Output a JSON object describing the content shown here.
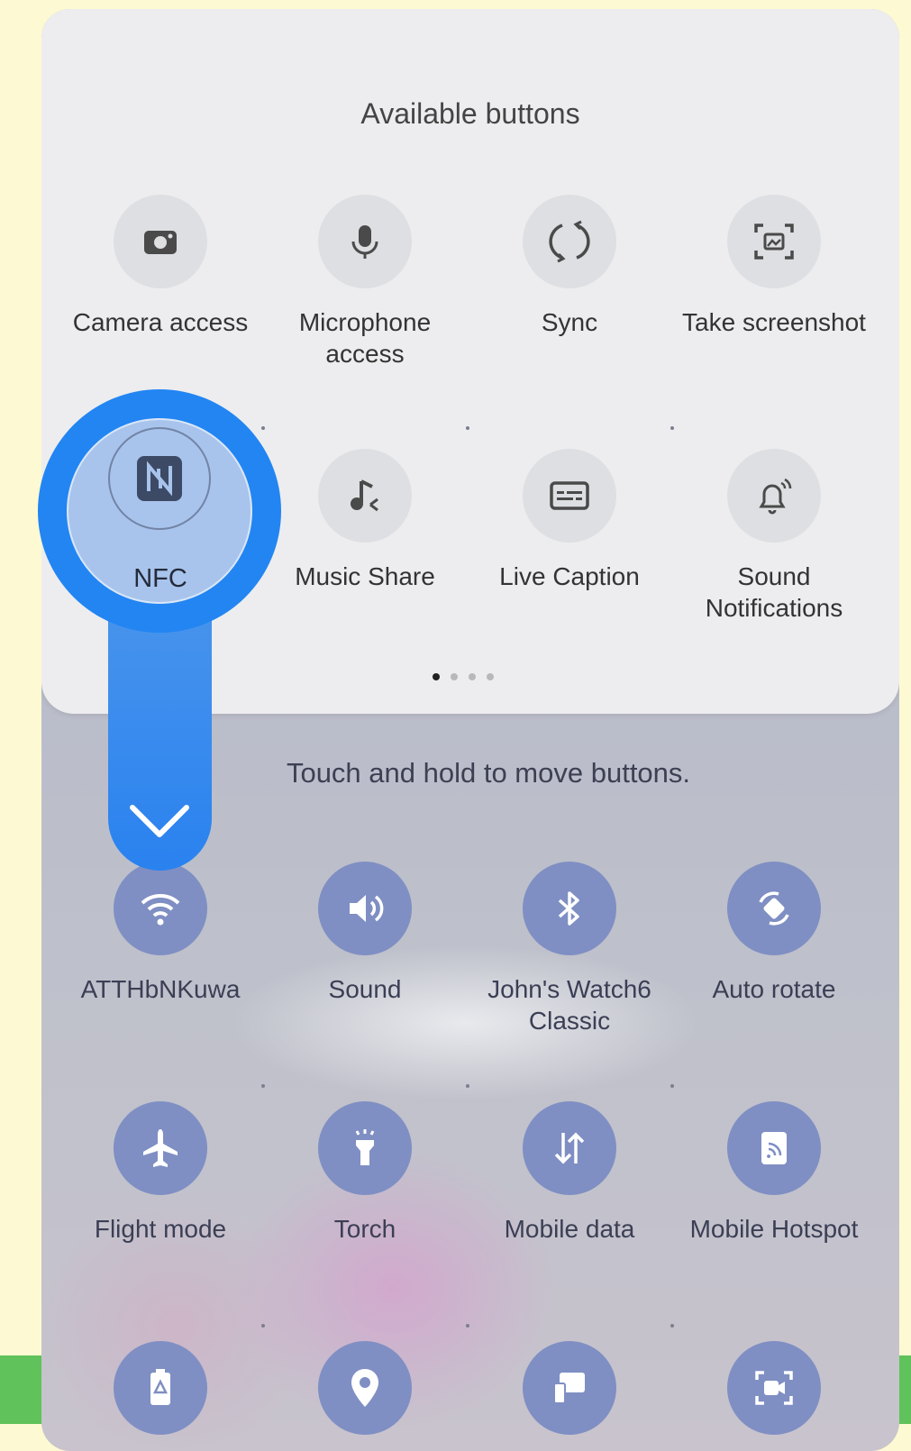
{
  "panel": {
    "title": "Available buttons",
    "page_indicator": {
      "pages": 4,
      "current": 1
    },
    "available_tiles": [
      {
        "label": "Camera access",
        "icon": "camera-icon"
      },
      {
        "label": "Microphone access",
        "icon": "microphone-icon"
      },
      {
        "label": "Sync",
        "icon": "sync-icon"
      },
      {
        "label": "Take screenshot",
        "icon": "screenshot-icon"
      },
      {
        "label": "NFC",
        "icon": "nfc-icon"
      },
      {
        "label": "Music Share",
        "icon": "music-share-icon"
      },
      {
        "label": "Live Caption",
        "icon": "live-caption-icon"
      },
      {
        "label": "Sound Notifications",
        "icon": "sound-notifications-icon"
      }
    ]
  },
  "hint": "Touch and hold to move buttons.",
  "active_tiles": [
    {
      "label": "ATTHbNKuwa",
      "icon": "wifi-icon"
    },
    {
      "label": "Sound",
      "icon": "sound-icon"
    },
    {
      "label": "John's Watch6 Classic",
      "icon": "bluetooth-icon"
    },
    {
      "label": "Auto rotate",
      "icon": "auto-rotate-icon"
    },
    {
      "label": "Flight mode",
      "icon": "airplane-icon"
    },
    {
      "label": "Torch",
      "icon": "torch-icon"
    },
    {
      "label": "Mobile data",
      "icon": "mobile-data-icon"
    },
    {
      "label": "Mobile Hotspot",
      "icon": "hotspot-icon"
    },
    {
      "label": "",
      "icon": "power-saving-icon"
    },
    {
      "label": "",
      "icon": "location-icon"
    },
    {
      "label": "",
      "icon": "smart-view-icon"
    },
    {
      "label": "",
      "icon": "screen-recorder-icon"
    }
  ],
  "drag": {
    "tile": "NFC",
    "accent": "#2285f2"
  },
  "colors": {
    "active_tile": "#7f8fc3",
    "inactive_tile": "#dedfe2",
    "background": "#fdf9d2",
    "strip": "#5fc25a"
  }
}
